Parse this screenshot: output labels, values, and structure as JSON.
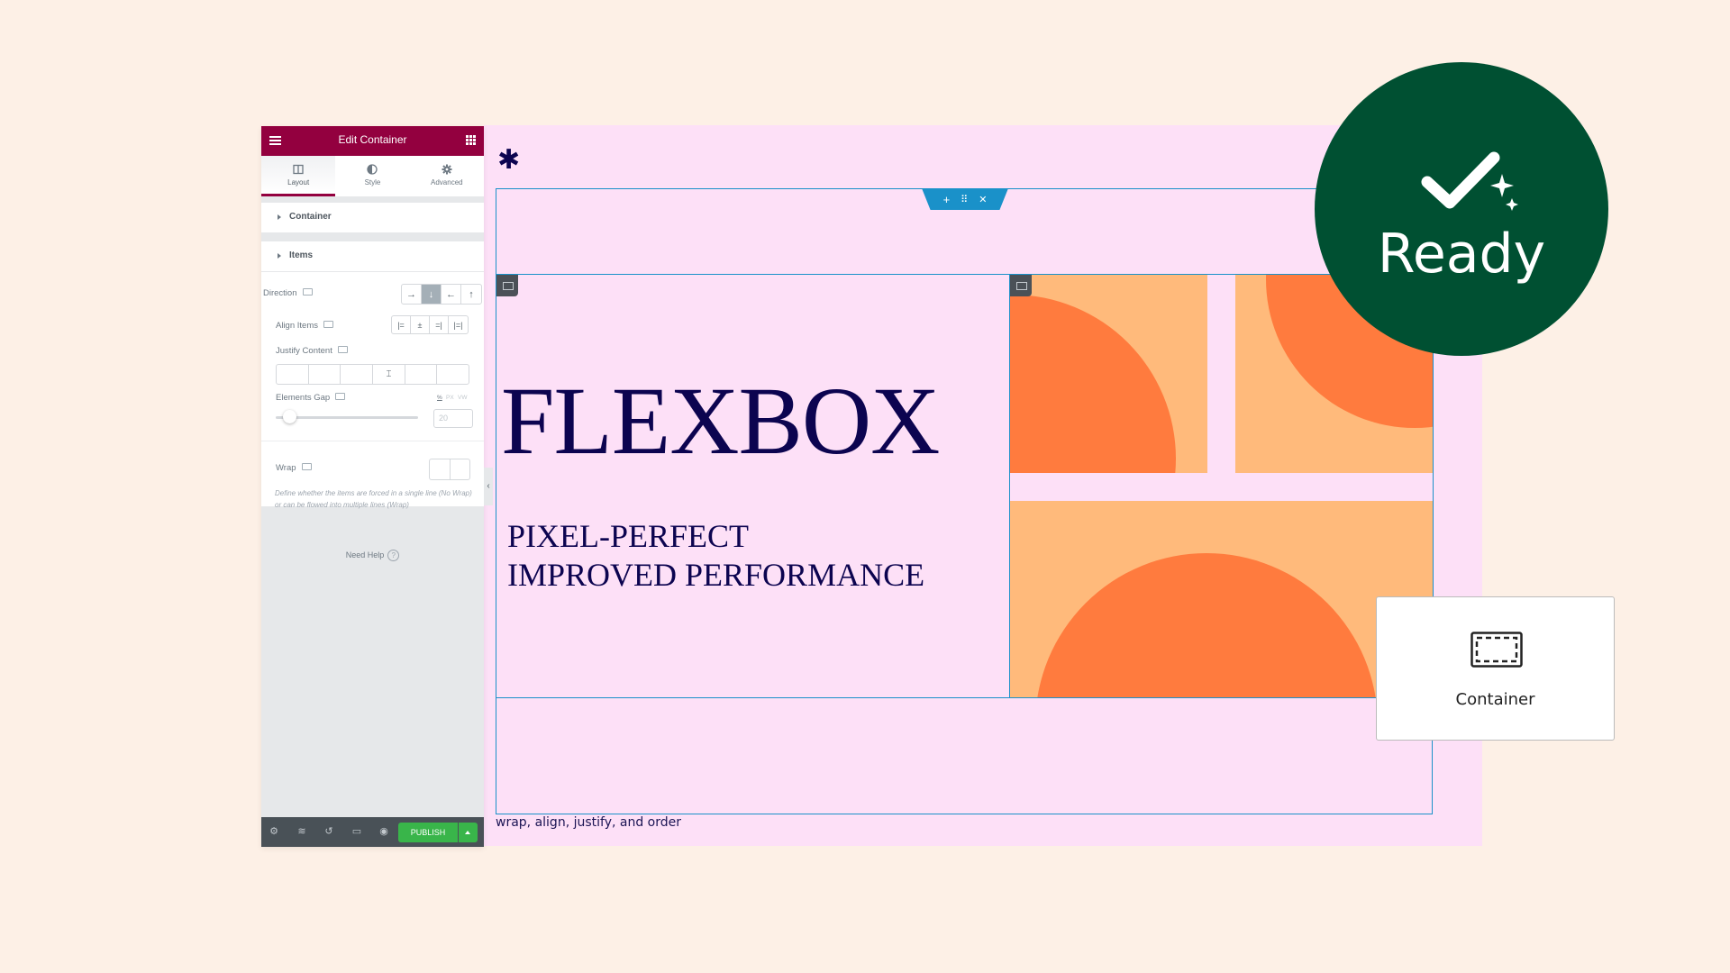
{
  "panel": {
    "title": "Edit Container",
    "tabs": [
      {
        "label": "Layout",
        "icon": "columns-icon",
        "active": true
      },
      {
        "label": "Style",
        "icon": "half-circle-icon",
        "active": false
      },
      {
        "label": "Advanced",
        "icon": "gear-icon",
        "active": false
      }
    ],
    "sections": [
      {
        "label": "Container"
      },
      {
        "label": "Items"
      }
    ],
    "controls": {
      "direction": {
        "label": "Direction",
        "options": [
          "→",
          "↓",
          "←",
          "↑"
        ],
        "selected": "↓"
      },
      "align_items": {
        "label": "Align Items",
        "options": [
          "align-start",
          "align-center",
          "align-end",
          "align-stretch"
        ]
      },
      "justify_content": {
        "label": "Justify Content",
        "selected_index": 3
      },
      "elements_gap": {
        "label": "Elements Gap",
        "units": [
          "%",
          "PX",
          "VW"
        ],
        "value": "20",
        "slider_value": 20
      },
      "wrap": {
        "label": "Wrap",
        "description": "Define whether the items are forced in a single line (No Wrap) or can be flowed into multiple lines (Wrap)"
      }
    },
    "need_help": "Need Help",
    "footer": {
      "icons": [
        "gear-icon",
        "layers-icon",
        "history-icon",
        "responsive-icon",
        "eye-icon"
      ],
      "publish_label": "PUBLISH"
    }
  },
  "canvas": {
    "headline": "FLEXBOX",
    "subline1": "PIXEL-PERFECT",
    "subline2": "IMPROVED PERFORMANCE",
    "caption": "wrap, align, justify, and order",
    "handle": {
      "add": "+",
      "drag": "⠿",
      "close": "✕"
    }
  },
  "badge": {
    "label": "Ready"
  },
  "widget": {
    "label": "Container"
  },
  "colors": {
    "panel_header": "#93003f",
    "publish": "#39b54a",
    "canvas": "#fde0f7",
    "background": "#fdf0e6",
    "badge": "#005032",
    "text": "#0c0450",
    "orange_dark": "#ff7b3e",
    "orange_light": "#ffba7b",
    "selection": "#1a91c9"
  }
}
